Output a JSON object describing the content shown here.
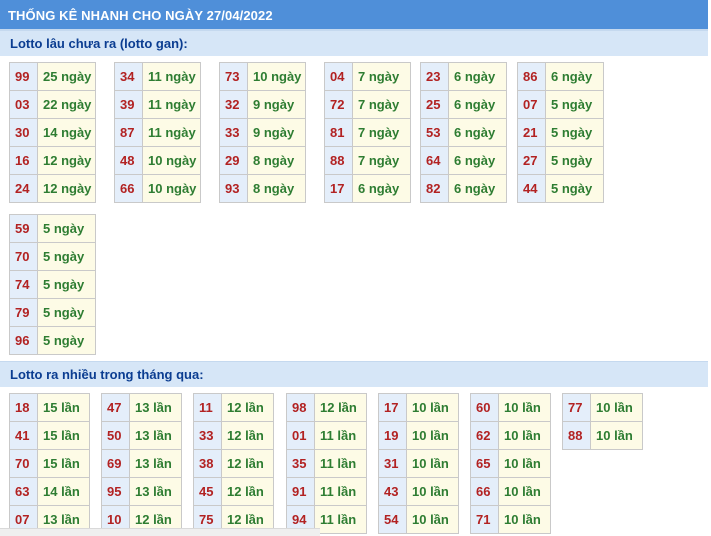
{
  "header": {
    "title": "THỐNG KÊ NHANH CHO NGÀY 27/04/2022"
  },
  "gan": {
    "title": "Lotto lâu chưa ra (lotto gan):",
    "groups": [
      [
        [
          "99",
          "25 ngày"
        ],
        [
          "03",
          "22 ngày"
        ],
        [
          "30",
          "14 ngày"
        ],
        [
          "16",
          "12 ngày"
        ],
        [
          "24",
          "12 ngày"
        ]
      ],
      [
        [
          "34",
          "11 ngày"
        ],
        [
          "39",
          "11 ngày"
        ],
        [
          "87",
          "11 ngày"
        ],
        [
          "48",
          "10 ngày"
        ],
        [
          "66",
          "10 ngày"
        ]
      ],
      [
        [
          "73",
          "10 ngày"
        ],
        [
          "32",
          "9 ngày"
        ],
        [
          "33",
          "9 ngày"
        ],
        [
          "29",
          "8 ngày"
        ],
        [
          "93",
          "8 ngày"
        ]
      ],
      [
        [
          "04",
          "7 ngày"
        ],
        [
          "72",
          "7 ngày"
        ],
        [
          "81",
          "7 ngày"
        ],
        [
          "88",
          "7 ngày"
        ],
        [
          "17",
          "6 ngày"
        ]
      ],
      [
        [
          "23",
          "6 ngày"
        ],
        [
          "25",
          "6 ngày"
        ],
        [
          "53",
          "6 ngày"
        ],
        [
          "64",
          "6 ngày"
        ],
        [
          "82",
          "6 ngày"
        ]
      ],
      [
        [
          "86",
          "6 ngày"
        ],
        [
          "07",
          "5 ngày"
        ],
        [
          "21",
          "5 ngày"
        ],
        [
          "27",
          "5 ngày"
        ],
        [
          "44",
          "5 ngày"
        ]
      ],
      [
        [
          "59",
          "5 ngày"
        ],
        [
          "70",
          "5 ngày"
        ],
        [
          "74",
          "5 ngày"
        ],
        [
          "79",
          "5 ngày"
        ],
        [
          "96",
          "5 ngày"
        ]
      ]
    ]
  },
  "nhieu": {
    "title": "Lotto ra nhiều trong tháng qua:",
    "groups": [
      [
        [
          "18",
          "15 lần"
        ],
        [
          "41",
          "15 lần"
        ],
        [
          "70",
          "15 lần"
        ],
        [
          "63",
          "14 lần"
        ],
        [
          "07",
          "13 lần"
        ]
      ],
      [
        [
          "47",
          "13 lần"
        ],
        [
          "50",
          "13 lần"
        ],
        [
          "69",
          "13 lần"
        ],
        [
          "95",
          "13 lần"
        ],
        [
          "10",
          "12 lần"
        ]
      ],
      [
        [
          "11",
          "12 lần"
        ],
        [
          "33",
          "12 lần"
        ],
        [
          "38",
          "12 lần"
        ],
        [
          "45",
          "12 lần"
        ],
        [
          "75",
          "12 lần"
        ]
      ],
      [
        [
          "98",
          "12 lần"
        ],
        [
          "01",
          "11 lần"
        ],
        [
          "35",
          "11 lần"
        ],
        [
          "91",
          "11 lần"
        ],
        [
          "94",
          "11 lần"
        ]
      ],
      [
        [
          "17",
          "10 lần"
        ],
        [
          "19",
          "10 lần"
        ],
        [
          "31",
          "10 lần"
        ],
        [
          "43",
          "10 lần"
        ],
        [
          "54",
          "10 lần"
        ]
      ],
      [
        [
          "60",
          "10 lần"
        ],
        [
          "62",
          "10 lần"
        ],
        [
          "65",
          "10 lần"
        ],
        [
          "66",
          "10 lần"
        ],
        [
          "71",
          "10 lần"
        ]
      ],
      [
        [
          "77",
          "10 lần"
        ],
        [
          "88",
          "10 lần"
        ]
      ]
    ]
  },
  "colors": {
    "header_bg": "#4f8fd9",
    "section_bg": "#d6e6f7",
    "number_color": "#b22222",
    "value_color": "#2e7d32"
  }
}
